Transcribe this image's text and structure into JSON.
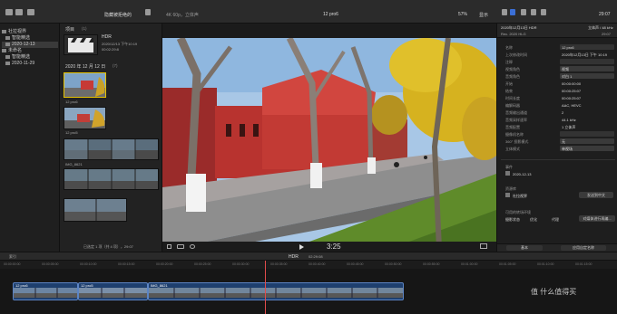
{
  "toolbar": {
    "hide_rejected": "隐藏被拒绝的",
    "format": "4K 60p，立体声",
    "project_name": "12 pro6",
    "zoom": "57%",
    "view": "显示",
    "timecode_top": "29:07"
  },
  "library": {
    "items": [
      {
        "label": "社拉视界",
        "level": 0
      },
      {
        "label": "智能精选",
        "level": 1
      },
      {
        "label": "2020-12-13",
        "level": 1,
        "selected": true
      },
      {
        "label": "未命名",
        "level": 0
      },
      {
        "label": "智能精选",
        "level": 1
      },
      {
        "label": "2020-11-29",
        "level": 1
      }
    ]
  },
  "browser": {
    "section_1": "项目",
    "section_1_count": "(1)",
    "project_thumb_title": "HDR",
    "project_thumb_date": "2020/12/13 下午10:19",
    "project_thumb_duration": "00:02:29:8",
    "section_2": "2020 年 12 月 12 日",
    "section_2_count": "(7)",
    "clips": [
      "12 pro6",
      "12 pro5",
      "IMG_8621",
      ""
    ],
    "footer": "已选定 1 项（共 4 项），29:07"
  },
  "viewer": {
    "timecode": "3:25",
    "hdr_label": "HDR",
    "hdr_time": "02:29:08"
  },
  "inspector": {
    "header_top": "2020年12月13日 HDR",
    "header_sub": "Rec. 2020 HLG",
    "header_right_top": "立体声 / 48 kHz",
    "header_right_sub": "29:07",
    "rows": [
      {
        "k": "名称",
        "v": "12 pro6",
        "type": "field"
      },
      {
        "k": "上次修改时间",
        "v": "2020年12月13日 下午 10:19"
      },
      {
        "k": "注释",
        "v": "",
        "type": "field"
      },
      {
        "k": "视频角色",
        "v": "视频",
        "type": "menu"
      },
      {
        "k": "音频角色",
        "v": "对白 1",
        "type": "menu"
      },
      {
        "k": "开始",
        "v": "00:00:00:00"
      },
      {
        "k": "结束",
        "v": "00:00:25:07"
      },
      {
        "k": "时间长度",
        "v": "00:00:25:07"
      },
      {
        "k": "编解码器",
        "v": "AAC, HEVC"
      },
      {
        "k": "音频输出通道",
        "v": "2"
      },
      {
        "k": "音频采样速率",
        "v": "44.1 kHz"
      },
      {
        "k": "音频配置",
        "v": "1 立体声"
      },
      {
        "k": "摄像机名称",
        "v": "",
        "type": "field"
      },
      {
        "k": "360° 投影模式",
        "v": "无",
        "type": "menu"
      },
      {
        "k": "立体模式",
        "v": "单视场",
        "type": "menu"
      }
    ],
    "event_label": "事件",
    "event_value": "2020-12-13",
    "library_label": "资源库",
    "library_value": "社拉视界",
    "library_button": "发送到中文",
    "applied_label": "可用的转场环境",
    "check_1": "摄影状态",
    "check_2": "优化",
    "check_3": "代理",
    "analyze_button": "对媒体进行再编...",
    "bottom_left": "基本",
    "bottom_right": "应用自定名称"
  },
  "timeline": {
    "index_label": "索引",
    "ruler": [
      "00:00:00:00",
      "00:00:05:00",
      "00:00:10:00",
      "00:00:15:00",
      "00:00:20:00",
      "00:00:25:00",
      "00:00:30:00",
      "00:00:35:00",
      "00:00:40:00",
      "00:00:45:00",
      "00:00:50:00",
      "00:00:55:00",
      "00:01:00:00",
      "00:01:05:00",
      "00:01:10:00",
      "00:01:15:00"
    ],
    "clips": [
      "12 pro6",
      "12 pro5",
      "IMG_8621"
    ]
  },
  "watermark": "值 什么值得买"
}
